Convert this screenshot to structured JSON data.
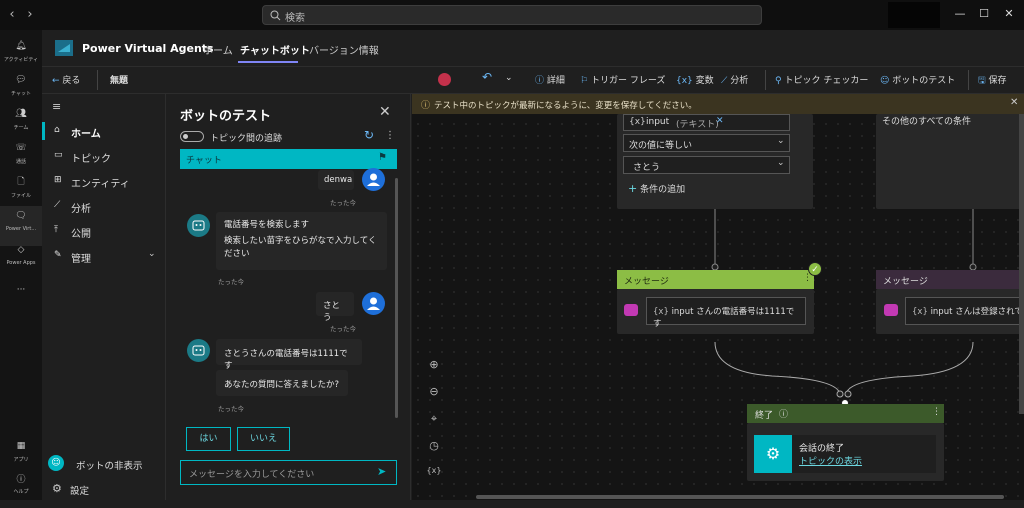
{
  "search": {
    "placeholder": "検索"
  },
  "rail": {
    "items": [
      {
        "label": "アクティビティ",
        "icon": "bell-icon"
      },
      {
        "label": "チャット",
        "icon": "chat-icon"
      },
      {
        "label": "チーム",
        "icon": "teams-icon"
      },
      {
        "label": "通話",
        "icon": "phone-icon"
      },
      {
        "label": "ファイル",
        "icon": "file-icon"
      },
      {
        "label": "Power Virt...",
        "icon": "pva-icon"
      },
      {
        "label": "Power Apps",
        "icon": "powerapps-icon"
      },
      {
        "label": "アプリ",
        "icon": "apps-icon"
      },
      {
        "label": "ヘルプ",
        "icon": "help-icon"
      }
    ]
  },
  "app": {
    "name": "Power Virtual Agents",
    "tabs": [
      "ホーム",
      "チャットボット",
      "バージョン情報"
    ]
  },
  "cmdbar": {
    "back": "戻る",
    "topic_title": "無題",
    "details": "詳細",
    "trigger": "トリガー フレーズ",
    "variables": "変数",
    "analytics": "分析",
    "checker": "トピック チェッカー",
    "test_bot": "ボットのテスト",
    "save": "保存"
  },
  "nav": {
    "items": [
      "ホーム",
      "トピック",
      "エンティティ",
      "分析",
      "公開",
      "管理"
    ],
    "hide_bot": "ボットの非表示",
    "settings": "設定"
  },
  "test": {
    "title": "ボットのテスト",
    "track_toggle": "トピック間の追跡",
    "chat_tab": "チャット",
    "user1": "denwa",
    "ts": "たった今",
    "bot1_line1": "電話番号を検索します",
    "bot1_line2": "検索したい苗字をひらがなで入力してください",
    "user2": "さとう",
    "bot2": "さとうさんの電話番号は1111です",
    "bot3": "あなたの質問に答えましたか?",
    "yes": "はい",
    "no": "いいえ",
    "input_placeholder": "メッセージを入力してください"
  },
  "banner": {
    "text": "テスト中のトピックが最新になるように、変更を保存してください。"
  },
  "canvas": {
    "var_chip": "input",
    "var_type": "(テキスト)",
    "operator": "次の値に等しい",
    "value": "さとう",
    "add_condition": "条件の追加",
    "other_conditions": "その他のすべての条件",
    "msg_header": "メッセージ",
    "msg_left": "input さんの電話番号は1111です",
    "msg_right": "input さんは登録されて",
    "var_tag": "{x}",
    "end_header": "終了",
    "end_title": "会話の終了",
    "end_link": "トピックの表示"
  },
  "colors": {
    "teal": "#00b7c3",
    "green": "#8cbd45",
    "purple": "#3b2b3d",
    "user_avatar": "#1e6fd9",
    "bot_avatar": "#1b7a86"
  }
}
